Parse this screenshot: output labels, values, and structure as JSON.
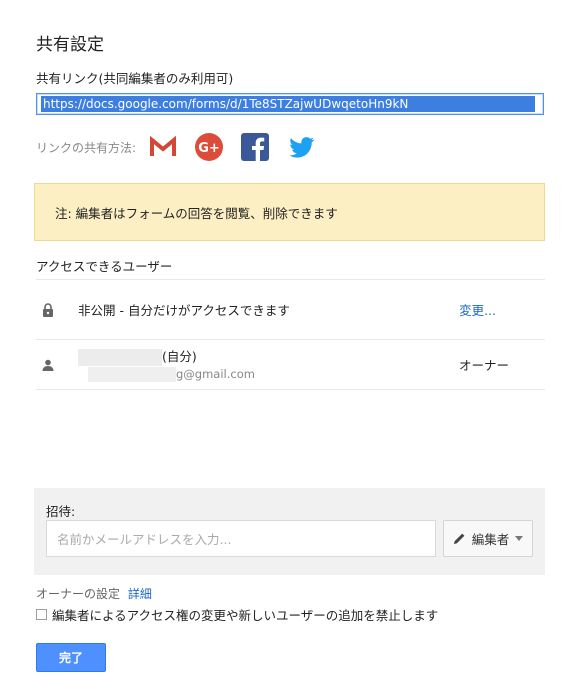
{
  "dialog": {
    "title": "共有設定"
  },
  "share_link": {
    "label": "共有リンク(共同編集者のみ利用可)",
    "value": "https://docs.google.com/forms/d/1Te8STZajwUDwqetoHn9kN"
  },
  "share_via": {
    "label": "リンクの共有方法:",
    "services": [
      "gmail-icon",
      "google-plus-icon",
      "facebook-icon",
      "twitter-icon"
    ]
  },
  "note": {
    "text": "注: 編集者はフォームの回答を閲覧、削除できます"
  },
  "access": {
    "title": "アクセスできるユーザー",
    "private_row": {
      "text": "非公開 - 自分だけがアクセスできます",
      "action": "変更..."
    },
    "owner_row": {
      "name_suffix": "(自分)",
      "email_suffix": "g@gmail.com",
      "role": "オーナー"
    }
  },
  "invite": {
    "label": "招待:",
    "placeholder": "名前かメールアドレスを入力...",
    "role_button": "編集者"
  },
  "owner_settings": {
    "label": "オーナーの設定",
    "details_link": "詳細",
    "checkbox_label": "編集者によるアクセス権の変更や新しいユーザーの追加を禁止します",
    "checked": false
  },
  "done_button": "完了",
  "colors": {
    "primary": "#4d90fe",
    "link": "#1a66cc",
    "note_bg": "#fcefc4",
    "gmail": "#d14836",
    "google_plus": "#dd4b39",
    "facebook": "#3b5998",
    "twitter": "#1da1f2"
  }
}
